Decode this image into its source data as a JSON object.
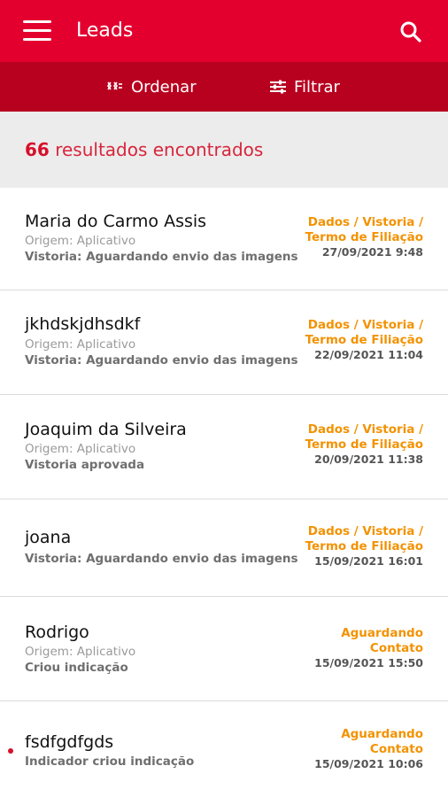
{
  "header": {
    "title": "Leads",
    "menu_icon": "hamburger-menu-icon",
    "search_icon": "search-icon",
    "bar_color": "#e3002f"
  },
  "toolbar": {
    "sort_label": "Ordenar",
    "filter_label": "Filtrar",
    "bar_color": "#b8001f"
  },
  "results": {
    "count": "66",
    "text": "resultados encontrados"
  },
  "colors": {
    "accent": "#d60f2a",
    "status": "#f39200"
  },
  "leads": [
    {
      "name": "Maria do Carmo Assis",
      "origin": "Origem: Aplicativo",
      "note": "Vistoria: Aguardando envio das imagens",
      "status_line1": "Dados / Vistoria /",
      "status_line2": "Termo de Filiação",
      "date": "27/09/2021 9:48"
    },
    {
      "name": "jkhdskjdhsdkf",
      "origin": "Origem: Aplicativo",
      "note": "Vistoria: Aguardando envio das imagens",
      "status_line1": "Dados / Vistoria /",
      "status_line2": "Termo de Filiação",
      "date": "22/09/2021 11:04"
    },
    {
      "name": "Joaquim da Silveira",
      "origin": "Origem: Aplicativo",
      "note": "Vistoria aprovada",
      "status_line1": "Dados / Vistoria /",
      "status_line2": "Termo de Filiação",
      "date": "20/09/2021 11:38"
    },
    {
      "name": "joana",
      "note": "Vistoria: Aguardando envio das imagens",
      "status_line1": "Dados / Vistoria /",
      "status_line2": "Termo de Filiação",
      "date": "15/09/2021 16:01"
    },
    {
      "name": "Rodrigo",
      "origin": "Origem: Aplicativo",
      "note": "Criou indicação",
      "status_line1": "Aguardando",
      "status_line2": "Contato",
      "date": "15/09/2021 15:50"
    },
    {
      "name": "fsdfgdfgds",
      "note": "Indicador criou indicação",
      "status_line1": "Aguardando",
      "status_line2": "Contato",
      "date": "15/09/2021 10:06"
    }
  ]
}
